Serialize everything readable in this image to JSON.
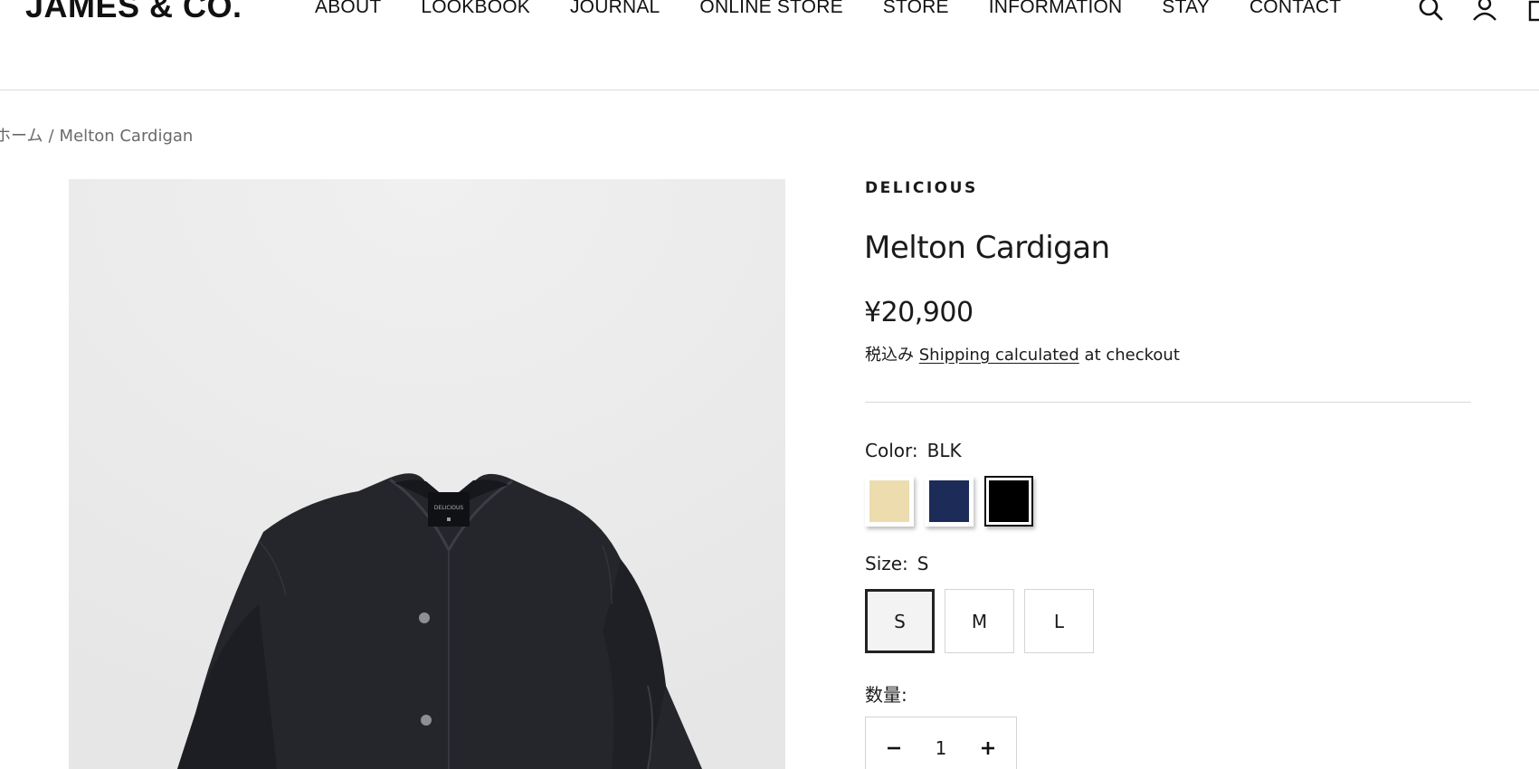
{
  "header": {
    "logo": "JAMES & CO.",
    "nav": [
      "ABOUT",
      "LOOKBOOK",
      "JOURNAL",
      "ONLINE STORE",
      "STORE",
      "INFORMATION",
      "STAY",
      "CONTACT"
    ],
    "icons": [
      "search-icon",
      "account-icon",
      "cart-icon"
    ]
  },
  "breadcrumb": {
    "home": "ホーム",
    "separator": "/",
    "current": "Melton Cardigan"
  },
  "product": {
    "vendor": "DELICIOUS",
    "title": "Melton Cardigan",
    "price": "¥20,900",
    "tax_prefix": "税込み",
    "shipping_link": "Shipping calculated",
    "tax_suffix": "at checkout",
    "image_label": "DELICIOUS",
    "color": {
      "label": "Color:",
      "selected": "BLK",
      "swatches": [
        {
          "name": "beige",
          "hex": "#ecdcae"
        },
        {
          "name": "navy",
          "hex": "#1c2b58"
        },
        {
          "name": "black",
          "hex": "#000000"
        }
      ]
    },
    "size": {
      "label": "Size:",
      "selected": "S",
      "options": [
        "S",
        "M",
        "L"
      ]
    },
    "quantity": {
      "label": "数量:",
      "value": "1"
    }
  }
}
